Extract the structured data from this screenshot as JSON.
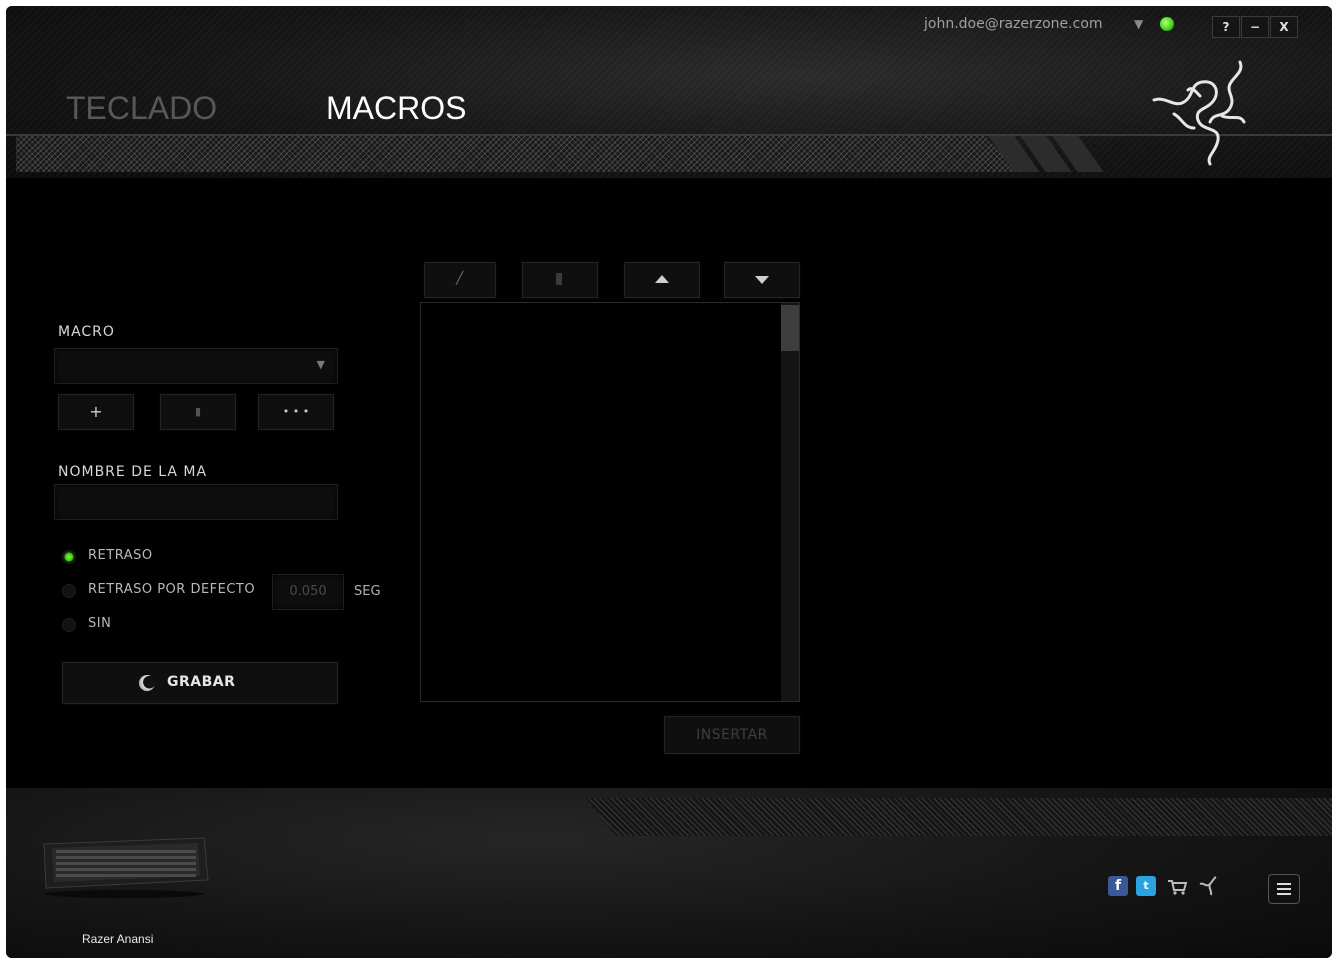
{
  "header": {
    "tabs": [
      {
        "label": "TECLADO",
        "active": false
      },
      {
        "label": "MACROS",
        "active": true
      }
    ],
    "account_email": "john.doe@razerzone.com",
    "window_buttons": {
      "help": "?",
      "minimize": "−",
      "close": "X"
    },
    "status_color": "#44d61a"
  },
  "macro": {
    "section_label": "MACRO",
    "dropdown_value": "",
    "buttons": {
      "add": "+",
      "delete": "▮",
      "more": "• • •"
    },
    "name_label": "NOMBRE DE LA MA",
    "name_value": "",
    "delay_options": [
      {
        "label": "RETRASO",
        "selected": true
      },
      {
        "label": "RETRASO POR DEFECTO",
        "selected": false
      },
      {
        "label": "SIN",
        "selected": false
      }
    ],
    "default_delay_value": "0.050",
    "delay_unit": "SEG",
    "record_label": "GRABAR"
  },
  "editor": {
    "toolbar_icons": [
      "edit-icon",
      "trash-icon",
      "arrow-up-icon",
      "arrow-down-icon"
    ],
    "insert_label": "INSERTAR"
  },
  "footer": {
    "device_name": "Razer Anansi",
    "social_icons": [
      "facebook-icon",
      "twitter-icon",
      "cart-icon",
      "razer-icon"
    ]
  },
  "colors": {
    "accent": "#44d61a",
    "background": "#000000",
    "text": "#d8d8d8"
  }
}
